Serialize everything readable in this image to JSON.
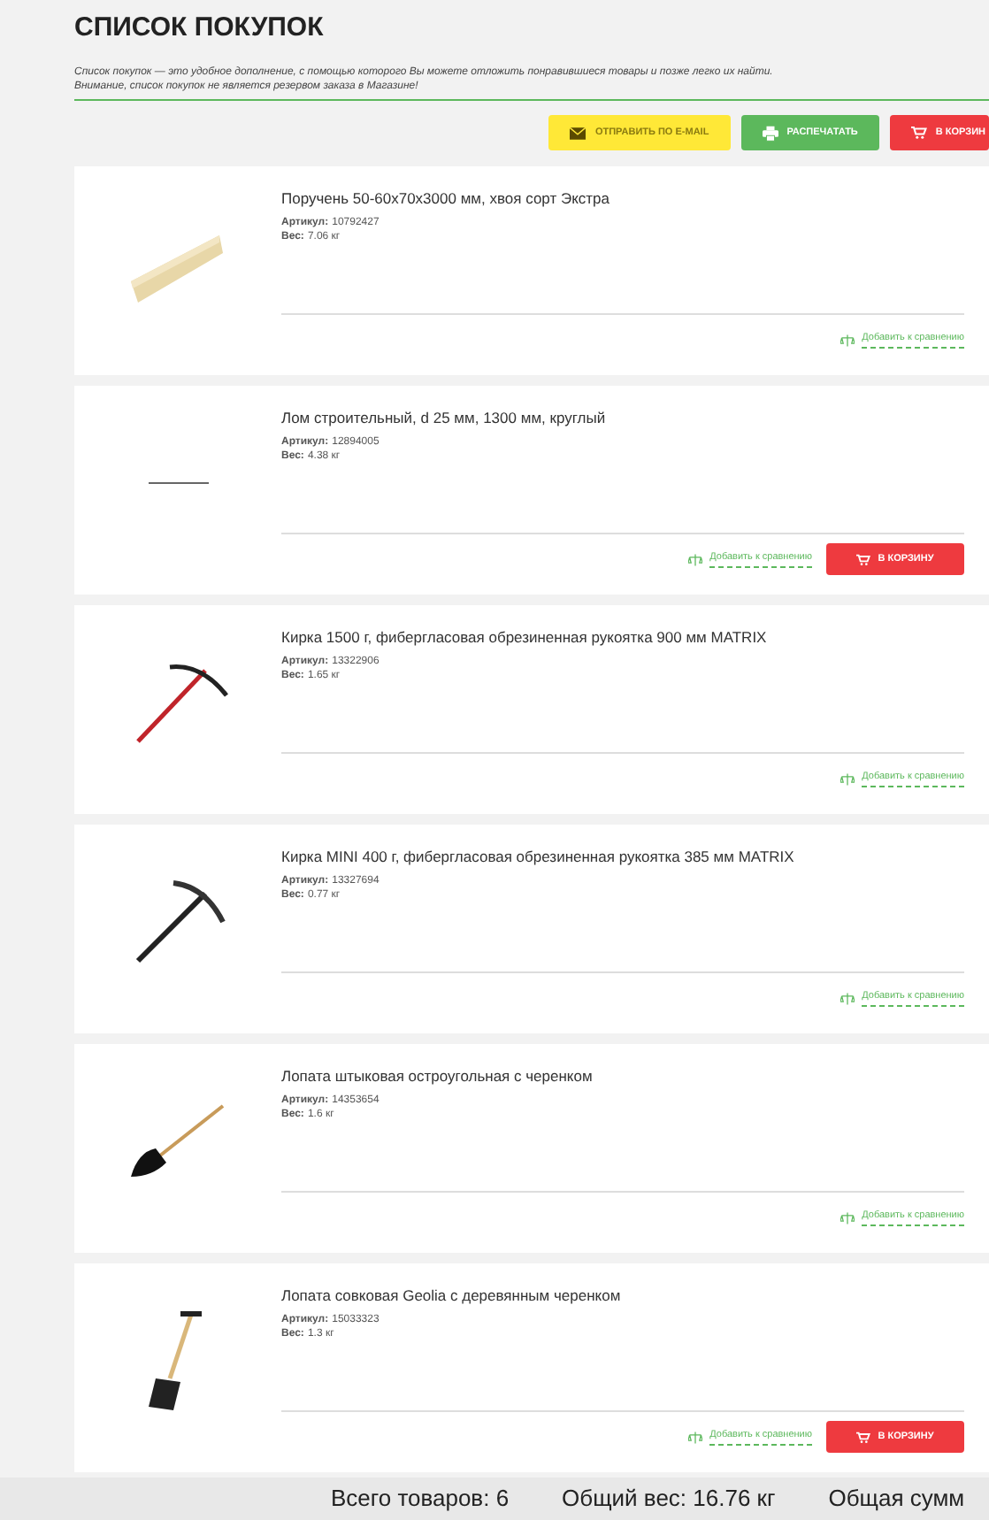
{
  "title": "СПИСОК ПОКУПОК",
  "description_lines": [
    "Список покупок — это удобное дополнение, с помощью которого Вы можете отложить понравившиеся товары и позже легко их найти.",
    "Внимание, список покупок не является резервом заказа в Магазине!"
  ],
  "toolbar": [
    {
      "kind": "email",
      "label": "ОТПРАВИТЬ ПО E-MAIL"
    },
    {
      "kind": "print",
      "label": "РАСПЕЧАТАТЬ"
    },
    {
      "kind": "cart",
      "label": "В КОРЗИН"
    }
  ],
  "items": [
    {
      "kind": "rail",
      "name": "Поручень 50-60x70x3000 мм, хвоя сорт Экстра",
      "sku_label": "Артикул:",
      "sku": "10792427",
      "weight_label": "Вес:",
      "weight": "7.06 кг",
      "compare": "Добавить к сравнению"
    },
    {
      "kind": "crowbar",
      "name": "Лом строительный, d 25 мм, 1300 мм, круглый",
      "sku_label": "Артикул:",
      "sku": "12894005",
      "weight_label": "Вес:",
      "weight": "4.38 кг",
      "compare": "Добавить к сравнению",
      "cart": "В КОРЗИНУ"
    },
    {
      "kind": "pickaxe",
      "name": "Кирка 1500 г, фибергласовая обрезиненная рукоятка 900 мм MATRIX",
      "sku_label": "Артикул:",
      "sku": "13322906",
      "weight_label": "Вес:",
      "weight": "1.65 кг",
      "compare": "Добавить к сравнению"
    },
    {
      "kind": "pickaxe_mini",
      "name": "Кирка MINI 400 г, фибергласовая обрезиненная рукоятка 385 мм MATRIX",
      "sku_label": "Артикул:",
      "sku": "13327694",
      "weight_label": "Вес:",
      "weight": "0.77 кг",
      "compare": "Добавить к сравнению"
    },
    {
      "kind": "spade",
      "name": "Лопата штыковая остроугольная с черенком",
      "sku_label": "Артикул:",
      "sku": "14353654",
      "weight_label": "Вес:",
      "weight": "1.6 кг",
      "compare": "Добавить к сравнению"
    },
    {
      "kind": "shovel",
      "name": "Лопата совковая Geolia с деревянным черенком",
      "sku_label": "Артикул:",
      "sku": "15033323",
      "weight_label": "Вес:",
      "weight": "1.3 кг",
      "compare": "Добавить к сравнению",
      "cart": "В КОРЗИНУ"
    }
  ],
  "footer": [
    "Всего товаров: 6",
    "Общий вес: 16.76 кг",
    "Общая сумм"
  ]
}
